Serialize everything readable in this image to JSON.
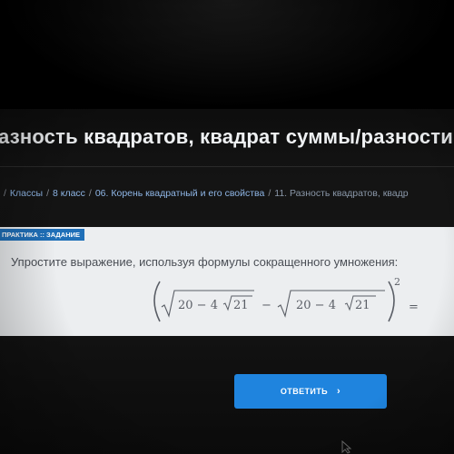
{
  "page": {
    "title": "азность квадратов, квадрат суммы/разности и",
    "breadcrumb": [
      {
        "label": "Классы"
      },
      {
        "label": "8 класс"
      },
      {
        "label": "06. Корень квадратный и его свойства"
      },
      {
        "label": "11. Разность квадратов, квадр"
      }
    ],
    "breadcrumb_separator": "/"
  },
  "task": {
    "badge": "ПРАКТИКА :: ЗАДАНИЕ",
    "instruction": "Упростите выражение, используя формулы сокращенного умножения:",
    "formula": {
      "term1_outer": "20 − 4",
      "term1_inner": "21",
      "minus": "−",
      "term2_outer": "20 − 4",
      "term2_inner": "21",
      "exponent": "2",
      "equals": "="
    }
  },
  "actions": {
    "answer_label": "ОТВЕТИТЬ",
    "answer_icon": "chevron-right-icon",
    "answer_color": "#1f84de"
  },
  "colors": {
    "badge": "#1f6fb8",
    "card_background": "#eceef0",
    "breadcrumb_link": "#8fb6e6"
  }
}
